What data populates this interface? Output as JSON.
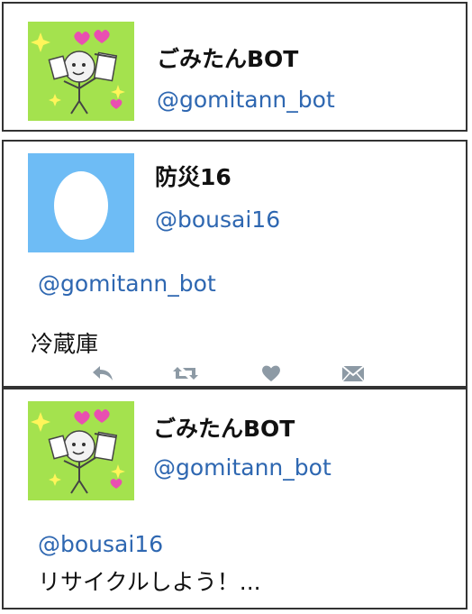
{
  "tweet_bot_1": {
    "display_name": "ごみたんBOT",
    "handle": "@gomitann_bot",
    "avatar_icon": "gomitan-mascot-icon"
  },
  "tweet_user": {
    "display_name": "防災16",
    "handle": "@bousai16",
    "avatar_icon": "default-egg-avatar-icon",
    "mention": "@gomitann_bot",
    "text": "冷蔵庫",
    "actions": [
      {
        "name": "reply",
        "icon": "reply-icon"
      },
      {
        "name": "retweet",
        "icon": "retweet-icon"
      },
      {
        "name": "like",
        "icon": "heart-icon"
      },
      {
        "name": "message",
        "icon": "envelope-icon"
      }
    ]
  },
  "tweet_bot_2": {
    "display_name": "ごみたんBOT",
    "handle": "@gomitann_bot",
    "avatar_icon": "gomitan-mascot-icon",
    "mention": "@bousai16",
    "text": "リサイクルしよう！..."
  },
  "colors": {
    "link_blue": "#2e67b1",
    "egg_background": "#6ebcf5",
    "mascot_background": "#a4e24e",
    "action_gray": "#8d9aa5"
  }
}
